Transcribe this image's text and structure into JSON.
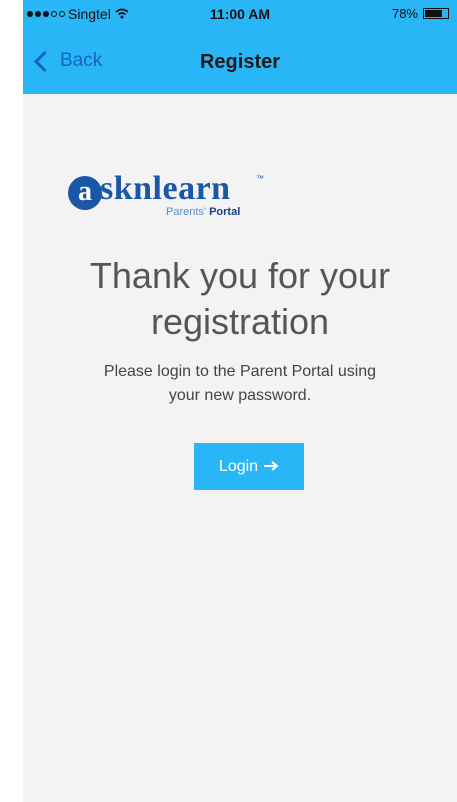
{
  "status_bar": {
    "carrier": "Singtel",
    "time": "11:00 AM",
    "battery": "78%",
    "battery_level": 0.78,
    "signal_icon": "signal-dots-icon",
    "wifi_icon": "wifi-icon",
    "battery_icon": "battery-icon"
  },
  "nav": {
    "back_label": "Back",
    "back_icon": "chevron-left-icon",
    "title": "Register"
  },
  "logo": {
    "circle_letter": "a",
    "word": "sknlearn",
    "trademark": "™",
    "sub_light": "Parents'",
    "sub_bold": "Portal"
  },
  "main": {
    "heading": "Thank you for your registration",
    "message": "Please login to the Parent Portal using your new password.",
    "login_label": "Login",
    "login_icon": "arrow-right-icon"
  },
  "colors": {
    "accent": "#29b6f6",
    "brand": "#1a57a6",
    "background": "#f3f3f3"
  }
}
